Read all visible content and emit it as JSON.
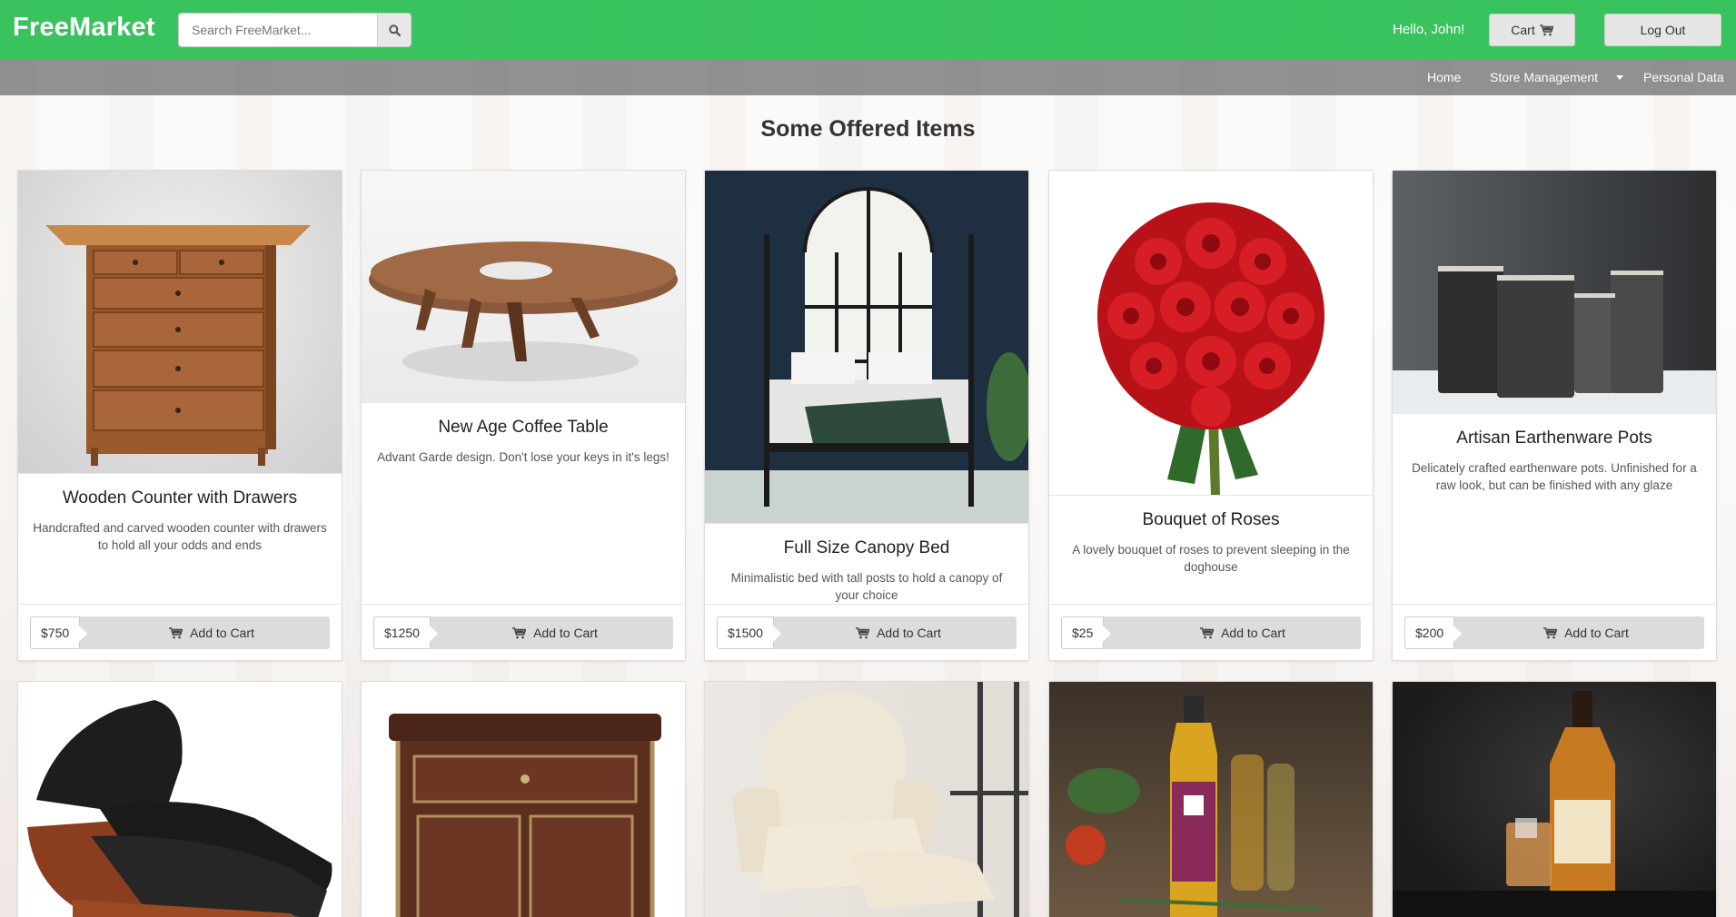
{
  "header": {
    "brand": "FreeMarket",
    "search_placeholder": "Search FreeMarket...",
    "greeting": "Hello, John!",
    "cart_label": "Cart",
    "logout_label": "Log Out"
  },
  "subnav": {
    "home": "Home",
    "store_management": "Store Management",
    "personal_data": "Personal Data"
  },
  "main": {
    "section_title": "Some Offered Items",
    "add_to_cart_label": "Add to Cart",
    "items": [
      {
        "title": "Wooden Counter with Drawers",
        "description": "Handcrafted and carved wooden counter with drawers to hold all your odds and ends",
        "price": "$750"
      },
      {
        "title": "New Age Coffee Table",
        "description": "Advant Garde design. Don't lose your keys in it's legs!",
        "price": "$1250"
      },
      {
        "title": "Full Size Canopy Bed",
        "description": "Minimalistic bed with tall posts to hold a canopy of your choice",
        "price": "$1500"
      },
      {
        "title": "Bouquet of Roses",
        "description": "A lovely bouquet of roses to prevent sleeping in the doghouse",
        "price": "$25"
      },
      {
        "title": "Artisan Earthenware Pots",
        "description": "Delicately crafted earthenware pots. Unfinished for a raw look, but can be finished with any glaze",
        "price": "$200"
      }
    ]
  },
  "colors": {
    "header_green": "#28be50",
    "subnav_gray": "#6e6e6e"
  }
}
